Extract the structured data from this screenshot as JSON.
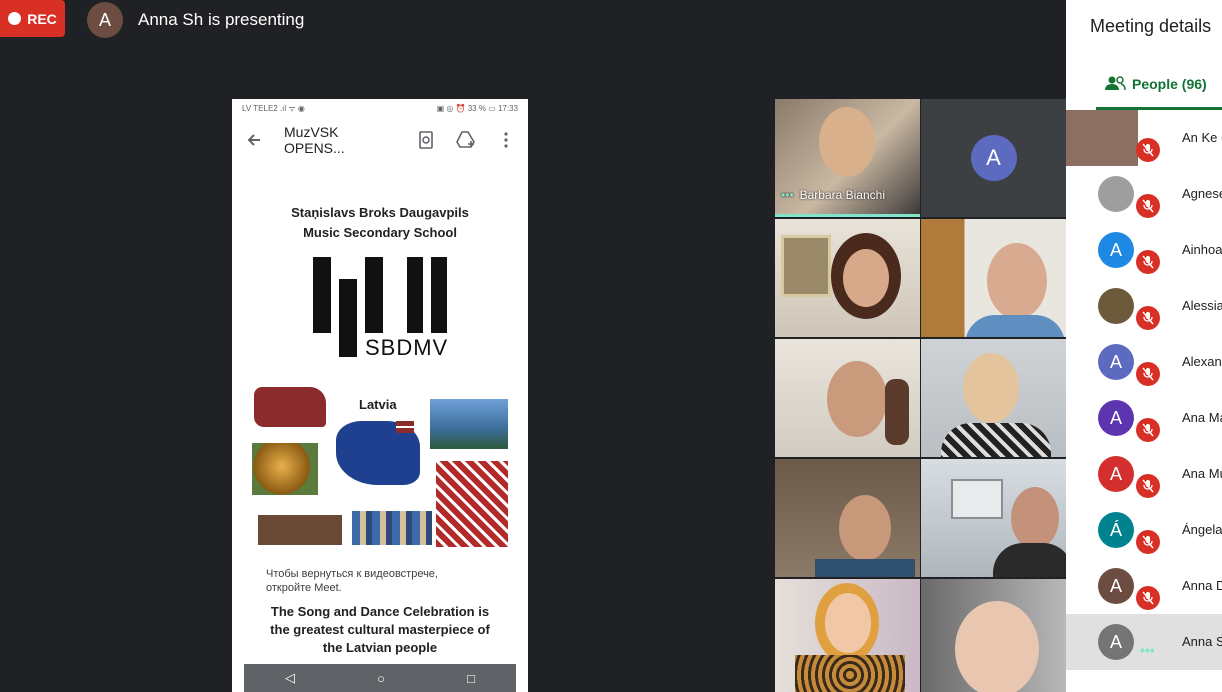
{
  "top": {
    "rec_label": "REC",
    "presenter_initial": "A",
    "presenting_text": "Anna Sh is presenting"
  },
  "phone": {
    "status_left": "LV TELE2 .ıl ᯤ ◉",
    "status_right": "▣ ◎ ⏰ 33 % ▭ 17:33",
    "app_title": "MuzVSK OPENS...",
    "school_line1": "Staņislavs Broks Daugavpils",
    "school_line2": "Music Secondary School",
    "logo_text": "SBDMV",
    "collage_label": "Latvia",
    "overlay_line1": "Чтобы вернуться к видеовстрече,",
    "overlay_line2": "откройте Meet.",
    "song_line1": "The Song and Dance Celebration is",
    "song_line2": "the greatest cultural masterpiece of",
    "song_line3": "the Latvian people"
  },
  "tiles": {
    "barbara_name": "Barbara Bianchi",
    "avatar_initial": "A"
  },
  "panel": {
    "title": "Meeting details",
    "people_tab": "People (96)",
    "people": [
      {
        "name": "An Ke (",
        "initial": "",
        "color": "#8d6e63"
      },
      {
        "name": "Agnese",
        "initial": "",
        "color": "#9e9e9e"
      },
      {
        "name": "Ainhoa",
        "initial": "A",
        "color": "#1e88e5"
      },
      {
        "name": "Alessia",
        "initial": "",
        "color": "#6d5a3a"
      },
      {
        "name": "Alexan",
        "initial": "A",
        "color": "#5c6bc0"
      },
      {
        "name": "Ana Ma",
        "initial": "A",
        "color": "#5e35b1"
      },
      {
        "name": "Ana Mu",
        "initial": "A",
        "color": "#d32f2f"
      },
      {
        "name": "Ángela",
        "initial": "Á",
        "color": "#00838f"
      },
      {
        "name": "Anna D",
        "initial": "A",
        "color": "#6d4c41"
      },
      {
        "name": "Anna S",
        "initial": "A",
        "color": "#757575"
      }
    ]
  },
  "colors": {
    "rec": "#d93025",
    "accent": "#137333",
    "background": "#202124"
  }
}
